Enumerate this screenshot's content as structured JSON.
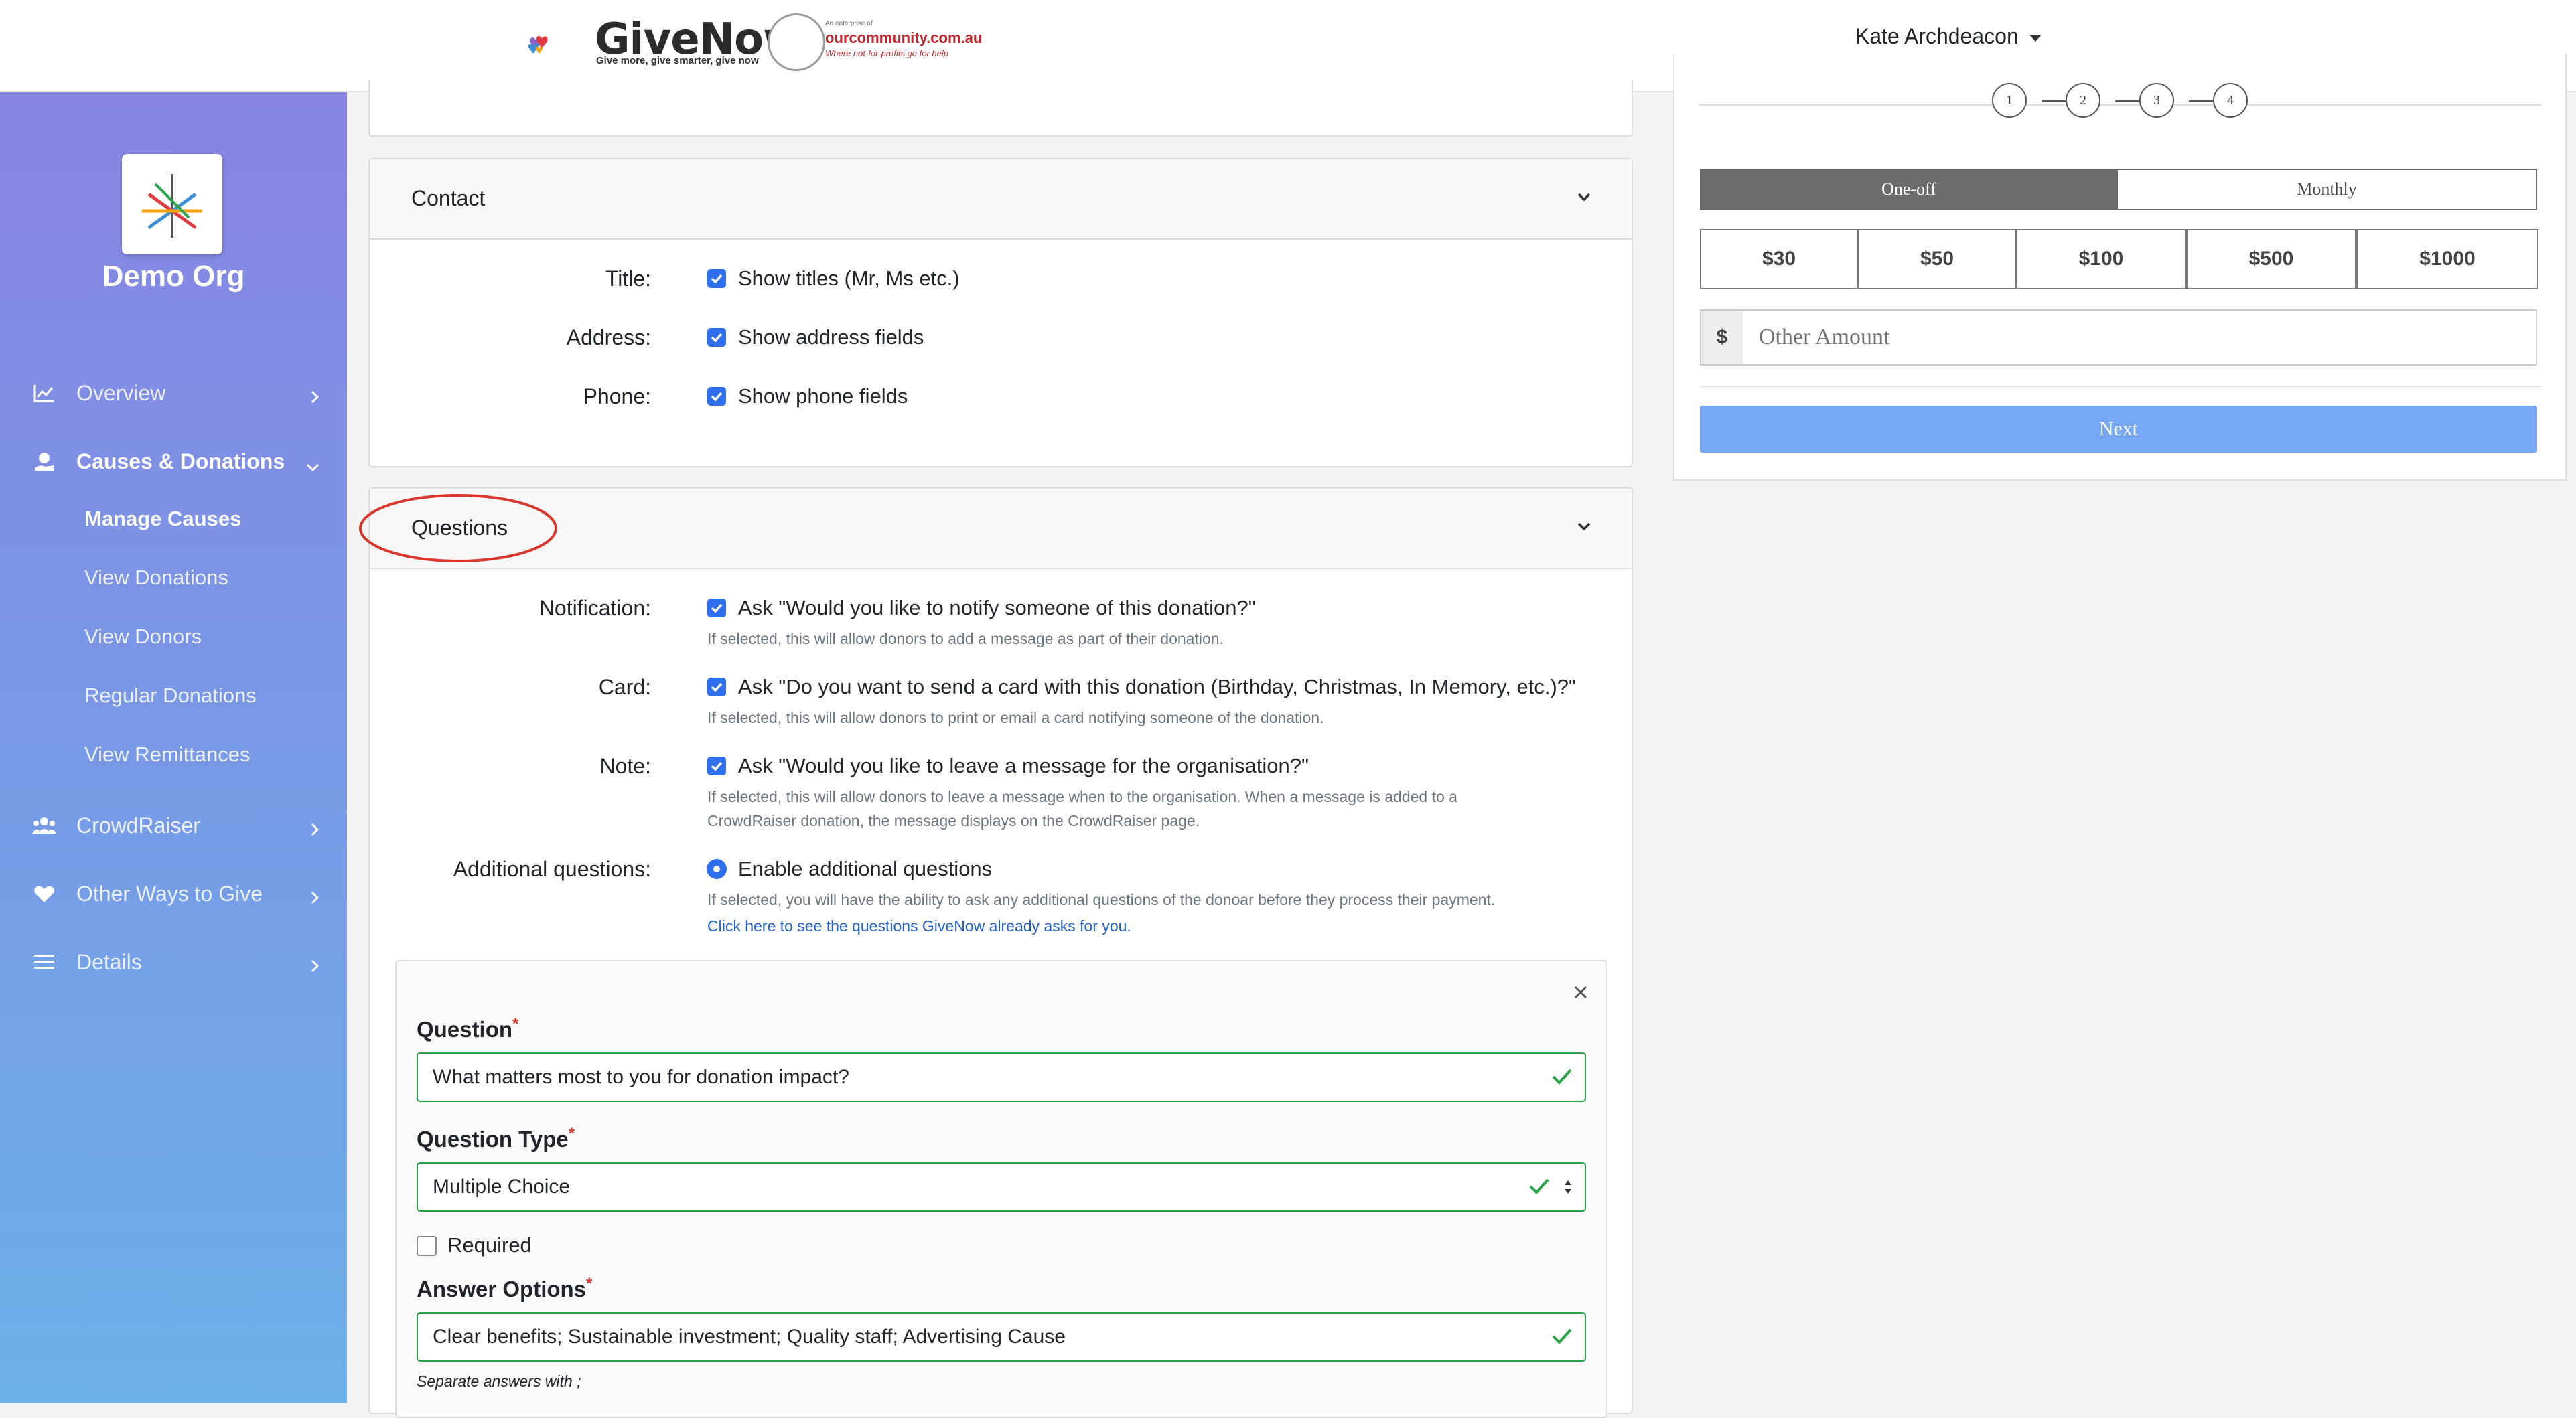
{
  "header": {
    "brand": "GiveNow",
    "brand_tagline": "Give more, give smarter, give now",
    "partner_small": "An enterprise of",
    "partner_name": "ourcommunity.com.au",
    "partner_tagline": "Where not-for-profits go for help",
    "user_name": "Kate Archdeacon"
  },
  "sidebar": {
    "org_name": "Demo Org",
    "items": [
      {
        "label": "Overview",
        "icon": "chart-line-icon"
      },
      {
        "label": "Causes & Donations",
        "icon": "hand-donation-icon"
      },
      {
        "label": "CrowdRaiser",
        "icon": "users-icon"
      },
      {
        "label": "Other Ways to Give",
        "icon": "heart-icon"
      },
      {
        "label": "Details",
        "icon": "list-icon"
      }
    ],
    "sub_items": [
      "Manage Causes",
      "View Donations",
      "View Donors",
      "Regular Donations",
      "View Remittances"
    ]
  },
  "contact": {
    "title": "Contact",
    "rows": [
      {
        "label": "Title:",
        "option": "Show titles (Mr, Ms etc.)"
      },
      {
        "label": "Address:",
        "option": "Show address fields"
      },
      {
        "label": "Phone:",
        "option": "Show phone fields"
      }
    ]
  },
  "questions": {
    "title": "Questions",
    "rows": [
      {
        "label": "Notification:",
        "option": "Ask \"Would you like to notify someone of this donation?\"",
        "help": "If selected, this will allow donors to add a message as part of their donation."
      },
      {
        "label": "Card:",
        "option": "Ask \"Do you want to send a card with this donation (Birthday, Christmas, In Memory, etc.)?\"",
        "help": "If selected, this will allow donors to print or email a card notifying someone of the donation."
      },
      {
        "label": "Note:",
        "option": "Ask \"Would you like to leave a message for the organisation?\"",
        "help_1": "If selected, this will allow donors to leave a message when to the organisation. When a message is added to a",
        "help_2": "CrowdRaiser donation, the message displays on the CrowdRaiser page."
      },
      {
        "label": "Additional questions:",
        "option": "Enable additional questions",
        "help": "If selected, you will have the ability to ask any additional questions of the donoar before they process their payment.",
        "link": "Click here to see the questions GiveNow already asks for you."
      }
    ]
  },
  "question_form": {
    "question_label": "Question",
    "question_value": "What matters most to you for donation impact?",
    "type_label": "Question Type",
    "type_value": "Multiple Choice",
    "required_label": "Required",
    "answers_label": "Answer Options",
    "answers_value": "Clear benefits; Sustainable investment; Quality staff; Advertising Cause",
    "answers_help": "Separate answers with ;",
    "required_marker": "*"
  },
  "preview": {
    "steps": [
      "1",
      "2",
      "3",
      "4"
    ],
    "frequency": [
      "One-off",
      "Monthly"
    ],
    "amounts": [
      "$30",
      "$50",
      "$100",
      "$500",
      "$1000"
    ],
    "currency": "$",
    "other_placeholder": "Other Amount",
    "next_label": "Next"
  },
  "colors": {
    "sidebar_top": "#8784e2",
    "sidebar_bottom": "#6cb0e9",
    "checkbox": "#2f6fed",
    "valid_border": "#2aa44a",
    "highlight_circle": "#d9372b",
    "next_button": "#76a8f5"
  }
}
